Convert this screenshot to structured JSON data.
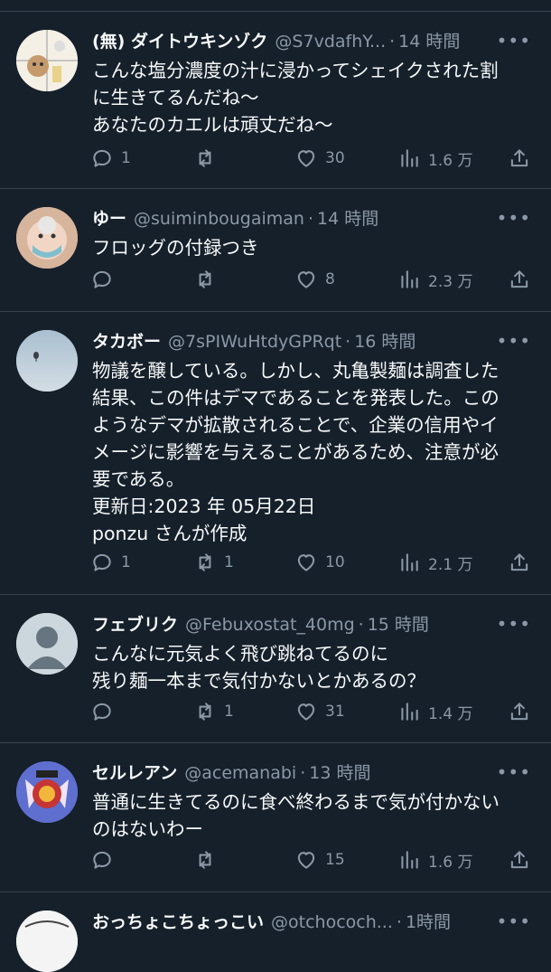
{
  "tweets": [
    {
      "name": "(無) ダイトウキンゾク",
      "handle": "@S7vdafhY...",
      "time": "14 時間",
      "lines": [
        "こんな塩分濃度の汁に浸かってシェイクされた割",
        "に生きてるんだね〜",
        "あなたのカエルは頑丈だね〜"
      ],
      "replies": "1",
      "retweets": "",
      "likes": "30",
      "views": "1.6 万"
    },
    {
      "name": "ゆー",
      "handle": "@suiminbougaiman",
      "time": "14 時間",
      "lines": [
        "フロッグの付録つき"
      ],
      "replies": "",
      "retweets": "",
      "likes": "8",
      "views": "2.3 万"
    },
    {
      "name": "タカボー",
      "handle": "@7sPIWuHtdyGPRqt",
      "time": "16 時間",
      "lines": [
        "物議を醸している。しかし、丸亀製麺は調査した",
        "結果、この件はデマであることを発表した。この",
        "ようなデマが拡散されることで、企業の信用やイ",
        "メージに影響を与えることがあるため、注意が必",
        "要である。",
        "更新日:2023 年 05月22日",
        "ponzu さんが作成"
      ],
      "replies": "1",
      "retweets": "1",
      "likes": "10",
      "views": "2.1 万"
    },
    {
      "name": "フェブリク",
      "handle": "@Febuxostat_40mg",
      "time": "15 時間",
      "lines": [
        "こんなに元気よく飛び跳ねてるのに",
        "残り麺一本まで気付かないとかあるの？"
      ],
      "replies": "",
      "retweets": "1",
      "likes": "31",
      "views": "1.4 万"
    },
    {
      "name": "セルレアン",
      "handle": "@acemanabi",
      "time": "13 時間",
      "lines": [
        "普通に生きてるのに食べ終わるまで気が付かない",
        "のはないわー"
      ],
      "replies": "",
      "retweets": "",
      "likes": "15",
      "views": "1.6 万"
    },
    {
      "name": "おっちょこちょっこい",
      "handle": "@otchococh...",
      "time": "1時間"
    }
  ]
}
